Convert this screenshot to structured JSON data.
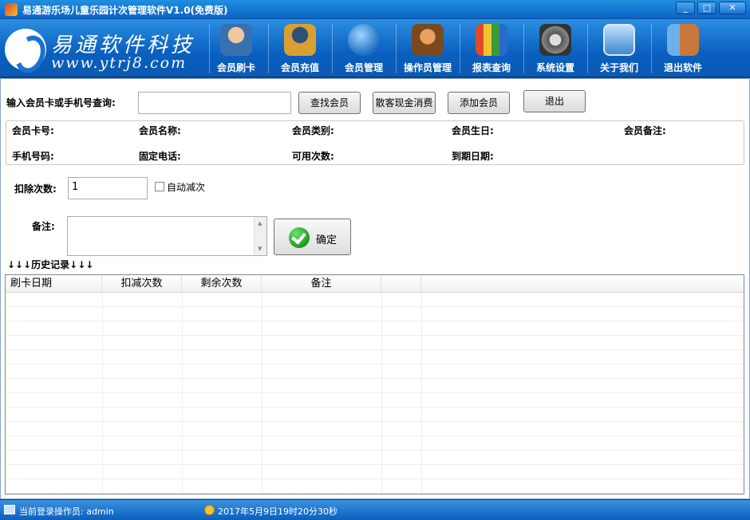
{
  "window": {
    "title": "易通游乐场儿童乐园计次管理软件V1.0(免费版)",
    "minimize": "0",
    "maximize": "1",
    "close": "r"
  },
  "logo": {
    "chinese": "易通软件科技",
    "url": "www.ytrj8.com"
  },
  "toolbar": [
    {
      "label": "会员刷卡",
      "icon": "member-swipe-icon",
      "color": "#3a6fb0"
    },
    {
      "label": "会员充值",
      "icon": "member-recharge-icon",
      "color": "#2d4f7a"
    },
    {
      "label": "会员管理",
      "icon": "member-manage-icon",
      "color": "#3b8fd6"
    },
    {
      "label": "操作员管理",
      "icon": "operator-manage-icon",
      "color": "#b07a3a"
    },
    {
      "label": "报表查询",
      "icon": "report-query-icon",
      "color": "#d9a23a"
    },
    {
      "label": "系统设置",
      "icon": "system-settings-icon",
      "color": "#6e6e6e"
    },
    {
      "label": "关于我们",
      "icon": "about-us-icon",
      "color": "#3f89d0"
    },
    {
      "label": "退出软件",
      "icon": "exit-software-icon",
      "color": "#c8783a"
    }
  ],
  "search": {
    "label": "输入会员卡或手机号查询:",
    "value": "",
    "find_button": "查找会员",
    "cash_button": "散客现金消费",
    "add_button": "添加会员",
    "exit_button": "退出"
  },
  "info": {
    "card_no": "会员卡号:",
    "name": "会员名称:",
    "type": "会员类别:",
    "birthday": "会员生日:",
    "note": "会员备注:",
    "phone": "手机号码:",
    "tel": "固定电话:",
    "available": "可用次数:",
    "expire": "到期日期:"
  },
  "deduct": {
    "label": "扣除次数:",
    "value": "1",
    "auto_label": "自动减次",
    "auto_checked": false
  },
  "remark": {
    "label": "备注:",
    "value": ""
  },
  "confirm_button": "确定",
  "history": {
    "title": "↓↓↓历史记录↓↓↓",
    "columns": [
      "刷卡日期",
      "扣减次数",
      "剩余次数",
      "备注",
      ""
    ],
    "rows": []
  },
  "status": {
    "operator": "当前登录操作员: admin",
    "time": "2017年5月9日19时20分30秒"
  }
}
